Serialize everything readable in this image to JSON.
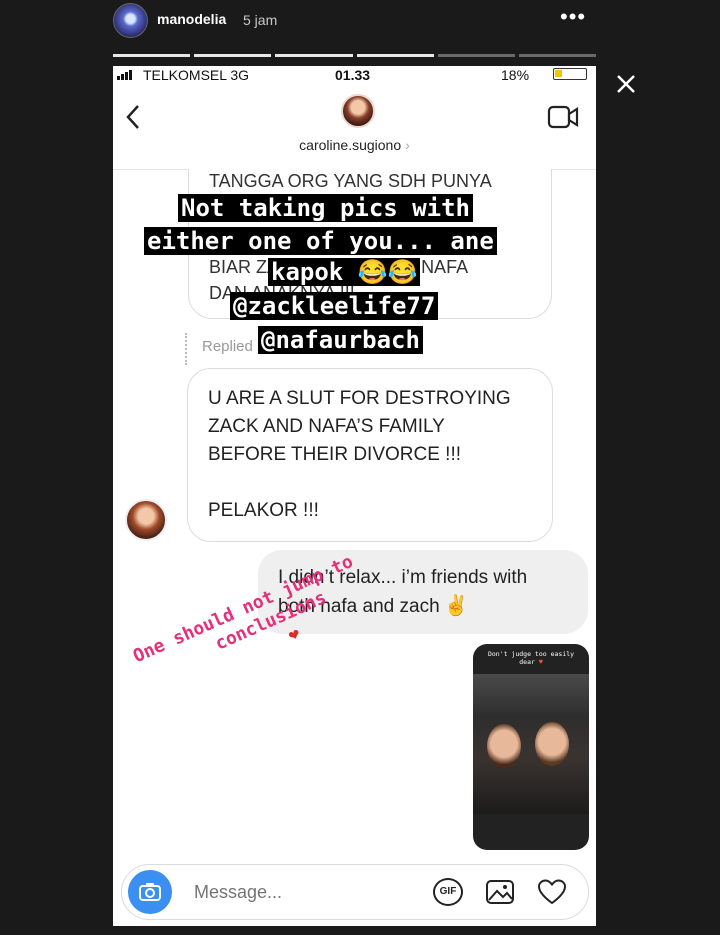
{
  "story": {
    "username": "manodelia",
    "time_ago": "5 jam",
    "more_icon": "more-dots-icon",
    "close_icon": "close-icon"
  },
  "statusbar": {
    "carrier": "TELKOMSEL  3G",
    "time": "01.33",
    "battery": "18%"
  },
  "chat": {
    "username": "caroline.sugiono",
    "chevron": "›",
    "quoted_lines": [
      "TANGGA ORG YANG SDH PUNYA",
      "BIAR ZACK KEMBALI KE NAFA",
      "DAN ANAKNYA !!!"
    ],
    "replied_label": "Replied",
    "message_lines": [
      "U ARE A SLUT FOR DESTROYING",
      "ZACK AND NAFA’S FAMILY",
      "BEFORE THEIR DIVORCE !!!",
      "",
      "PELAKOR !!!"
    ],
    "own_lines": [
      "I didn’t relax... i’m friends with",
      "both nafa and zach"
    ],
    "own_emoji": "✌",
    "shared_caption": "Don't judge too easily dear",
    "shared_heart": "♥"
  },
  "composer": {
    "placeholder": "Message...",
    "gif_label": "GIF"
  },
  "overlay": {
    "line1": "Not taking pics with",
    "line2": "either one of you... ane",
    "line3": "kapok",
    "line3_emoji": "😂😂",
    "line4": "@zackleelife77",
    "line5": "@nafaurbach",
    "tilt_line1": "One should not jump to",
    "tilt_line2": "conclusions",
    "tilt_heart": "❤"
  },
  "colors": {
    "accent_blue": "#3b8ff0",
    "tilt_text": "#e52f7a"
  }
}
